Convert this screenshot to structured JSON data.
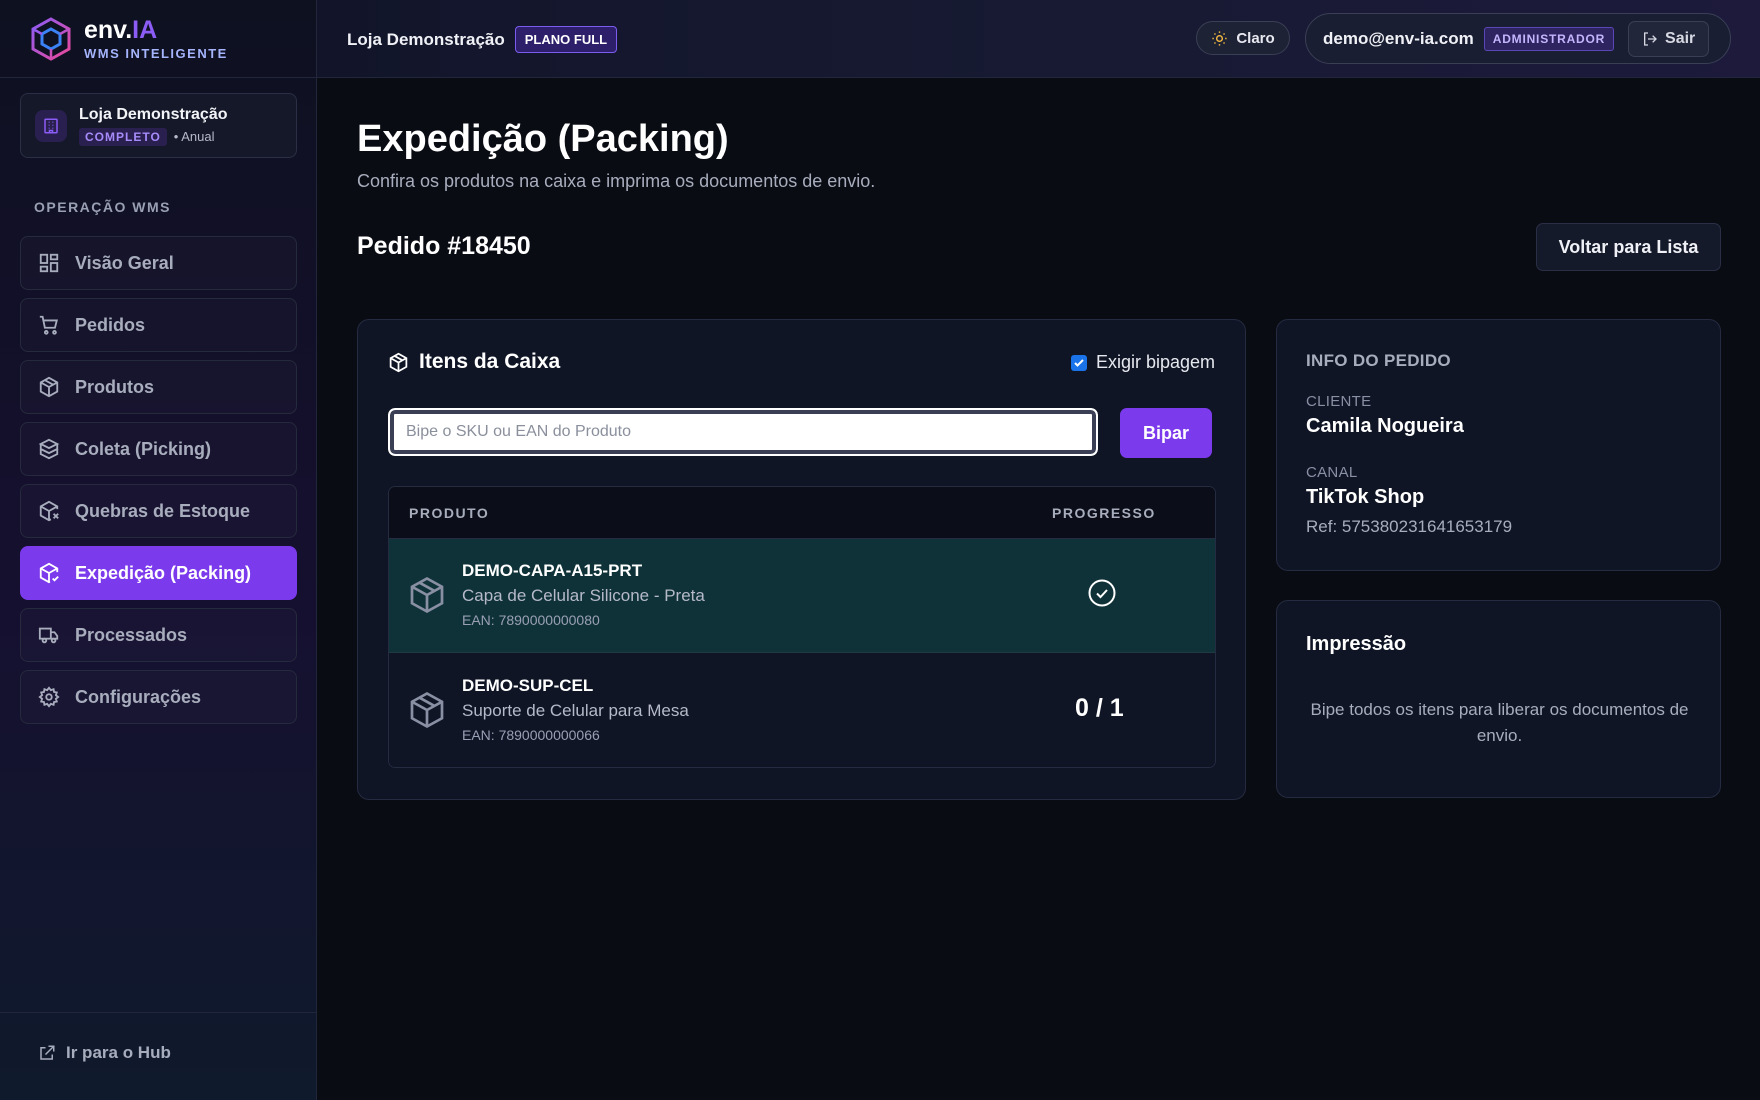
{
  "brand": {
    "name_main": "env.",
    "name_accent": "IA",
    "subtitle": "WMS INTELIGENTE"
  },
  "store_card": {
    "name": "Loja Demonstração",
    "badge": "COMPLETO",
    "plan": "• Anual"
  },
  "sidebar": {
    "section_label": "OPERAÇÃO WMS",
    "items": [
      {
        "label": "Visão Geral",
        "icon": "grid-icon",
        "active": false
      },
      {
        "label": "Pedidos",
        "icon": "cart-icon",
        "active": false
      },
      {
        "label": "Produtos",
        "icon": "package-icon",
        "active": false
      },
      {
        "label": "Coleta (Picking)",
        "icon": "boxes-icon",
        "active": false
      },
      {
        "label": "Quebras de Estoque",
        "icon": "package-x-icon",
        "active": false
      },
      {
        "label": "Expedição (Packing)",
        "icon": "package-check-icon",
        "active": true
      },
      {
        "label": "Processados",
        "icon": "truck-icon",
        "active": false
      },
      {
        "label": "Configurações",
        "icon": "gear-icon",
        "active": false
      }
    ],
    "hub_link": "Ir para o Hub"
  },
  "header": {
    "store_name": "Loja Demonstração",
    "plan_badge": "PLANO FULL",
    "theme_label": "Claro",
    "user_email": "demo@env-ia.com",
    "role_badge": "ADMINISTRADOR",
    "logout_label": "Sair"
  },
  "page": {
    "title": "Expedição (Packing)",
    "subtitle": "Confira os produtos na caixa e imprima os documentos de envio.",
    "order_title": "Pedido #18450",
    "back_button": "Voltar para Lista"
  },
  "items_box": {
    "title": "Itens da Caixa",
    "require_scan_label": "Exigir bipagem",
    "require_scan_checked": true,
    "scan_placeholder": "Bipe o SKU ou EAN do Produto",
    "scan_value": "",
    "scan_button": "Bipar",
    "col_product": "PRODUTO",
    "col_progress": "PROGRESSO",
    "rows": [
      {
        "sku": "DEMO-CAPA-A15-PRT",
        "name": "Capa de Celular Silicone - Preta",
        "ean": "EAN: 7890000000080",
        "status": "complete"
      },
      {
        "sku": "DEMO-SUP-CEL",
        "name": "Suporte de Celular para Mesa",
        "ean": "EAN: 7890000000066",
        "progress": "0 / 1",
        "status": "pending"
      }
    ]
  },
  "order_info": {
    "title": "INFO DO PEDIDO",
    "client_label": "CLIENTE",
    "client": "Camila Nogueira",
    "channel_label": "CANAL",
    "channel": "TikTok Shop",
    "ref": "Ref: 575380231641653179"
  },
  "printing": {
    "title": "Impressão",
    "message": "Bipe todos os itens para liberar os documentos de envio."
  },
  "colors": {
    "accent": "#7c3aed",
    "done_row": "#0f3238",
    "background": "#0a0c14"
  }
}
